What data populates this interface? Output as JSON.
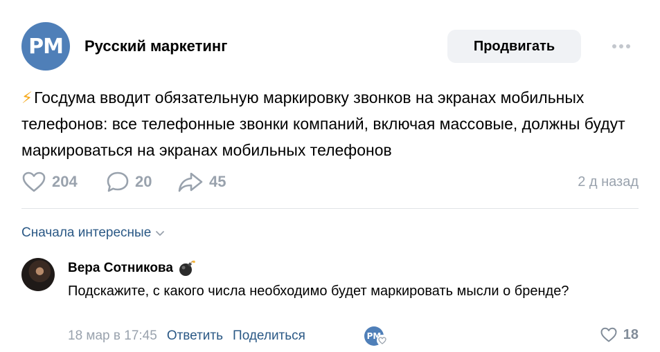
{
  "header": {
    "avatar_text": "PM",
    "group_name": "Русский маркетинг",
    "promote_label": "Продвигать"
  },
  "post": {
    "bolt_emoji": "⚡",
    "text": "Госдума вводит обязательную маркировку звонков на экранах мобильных телефонов: все телефонные звонки компаний, включая массовые, должны будут маркироваться на экранах мобильных телефонов",
    "likes": "204",
    "comments": "20",
    "shares": "45",
    "time": "2 д назад"
  },
  "comments_section": {
    "sort_label": "Сначала интересные"
  },
  "comment": {
    "author": "Вера Сотникова",
    "text": "Подскажите, с какого числа необходимо будет маркировать мысли о бренде?",
    "time": "18 мар в 17:45",
    "reply_label": "Ответить",
    "share_label": "Поделиться",
    "liked_by_avatar_text": "PM",
    "likes": "18"
  },
  "colors": {
    "brand_avatar": "#4f7fb8",
    "link": "#2a5885",
    "muted": "#99a2ad",
    "button_bg": "#f0f2f5"
  }
}
